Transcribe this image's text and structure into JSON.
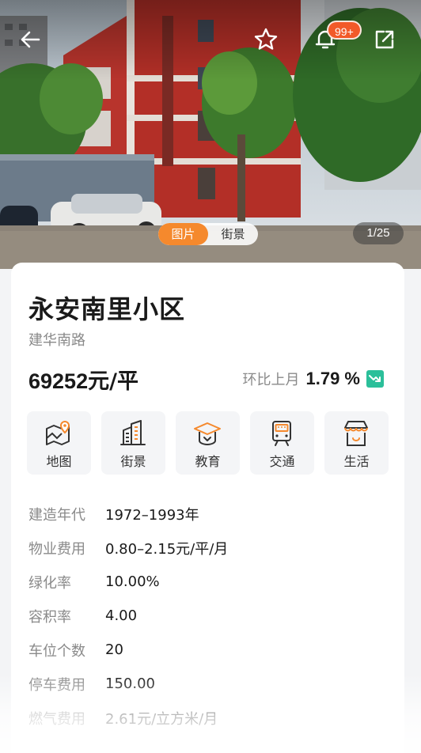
{
  "gallery": {
    "tabs": [
      {
        "label": "图片",
        "active": true
      },
      {
        "label": "街景",
        "active": false
      }
    ],
    "counter": "1/25",
    "notification_badge": "99+"
  },
  "header_icons": {
    "back": "arrow-left-icon",
    "favorite": "star-outline-icon",
    "notifications": "bell-icon",
    "share": "share-icon"
  },
  "community": {
    "name": "永安南里小区",
    "road": "建华南路",
    "price": "69252",
    "price_unit": "元/平",
    "mom_label": "环比上月",
    "mom_value": "1.79 %",
    "mom_trend": "down",
    "trend_color": "#2bbf9a"
  },
  "quick_links": [
    {
      "label": "地图",
      "icon": "map-icon"
    },
    {
      "label": "街景",
      "icon": "street-view-icon"
    },
    {
      "label": "教育",
      "icon": "education-icon"
    },
    {
      "label": "交通",
      "icon": "train-icon"
    },
    {
      "label": "生活",
      "icon": "shop-icon"
    }
  ],
  "details": [
    {
      "label": "建造年代",
      "value": "1972–1993年"
    },
    {
      "label": "物业费用",
      "value": "0.80–2.15元/平/月"
    },
    {
      "label": "绿化率",
      "value": "10.00%"
    },
    {
      "label": "容积率",
      "value": "4.00"
    },
    {
      "label": "车位个数",
      "value": "20"
    },
    {
      "label": "停车费用",
      "value": "150.00"
    },
    {
      "label": "燃气费用",
      "value": "2.61元/立方米/月"
    }
  ],
  "colors": {
    "accent": "#f5892d",
    "badge": "#f25a29",
    "icon_orange": "#f5892d"
  }
}
